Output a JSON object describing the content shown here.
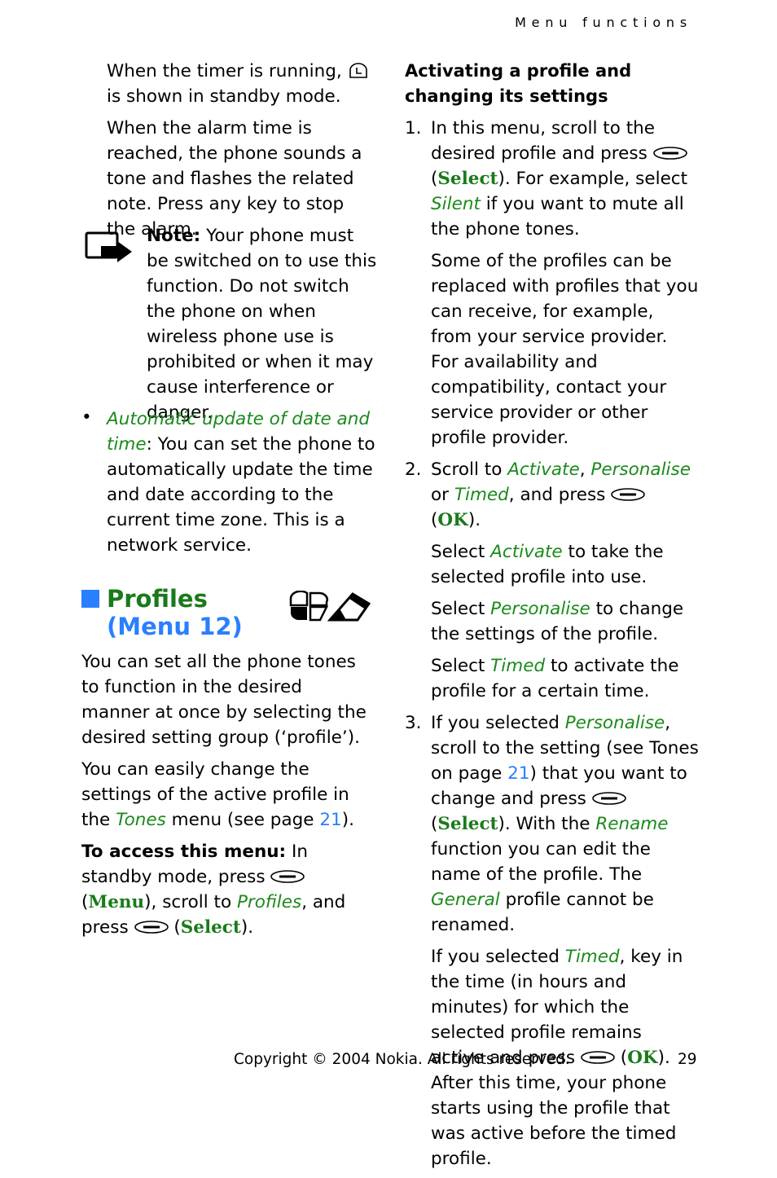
{
  "header": {
    "section": "Menu functions"
  },
  "left": {
    "timer_p1_a": "When the timer is running,",
    "timer_p1_b": "is shown in standby mode.",
    "alarm_p": "When the alarm time is reached, the phone sounds a tone and flashes the related note. Press any key to stop the alarm.",
    "note_label": "Note:",
    "note_text": "Your phone must be switched on to use this function. Do not switch the phone on when wireless phone use is prohibited or when it may cause interference or danger.",
    "bullet_link": "Automatic update of date and time",
    "bullet_text": ": You can set the phone to automatically update the time and date according to the current time zone. This is a network service.",
    "profiles_title": "Profiles",
    "profiles_menu": "(Menu 12)",
    "intro_p": "You can set all the phone tones to function in the desired manner at once by selecting the desired setting group (‘profile’).",
    "change_a": "You can easily change the settings of the active profile in the",
    "change_link": "Tones",
    "change_b": "menu (see page",
    "change_page": "21",
    "change_c": ").",
    "access_label": "To access this menu:",
    "access_a": "In standby mode, press",
    "access_menu": "Menu",
    "access_b": "), scroll to",
    "access_profiles": "Profiles",
    "access_c": ", and press",
    "access_select": "Select",
    "access_d": ")."
  },
  "right": {
    "heading": "Activating a profile and changing its settings",
    "s1_num": "1.",
    "s1_a": "In this menu, scroll to the desired profile and press",
    "s1_select": "Select",
    "s1_b": "). For example, select",
    "s1_silent": "Silent",
    "s1_c": "if you want to mute all the phone tones.",
    "s1_p2": "Some of the profiles can be replaced with profiles that you can receive, for example, from your service provider. For availability and compatibility, contact your service provider or other profile provider.",
    "s2_num": "2.",
    "s2_a": "Scroll to",
    "s2_activate": "Activate",
    "s2_personalise": "Personalise",
    "s2_or": "or",
    "s2_timed": "Timed",
    "s2_b": ", and press",
    "s2_ok": "OK",
    "s2_p2_a": "Select",
    "s2_p2_link": "Activate",
    "s2_p2_b": "to take the selected profile into use.",
    "s2_p3_a": "Select",
    "s2_p3_link": "Personalise",
    "s2_p3_b": "to change the settings of the profile.",
    "s2_p4_a": "Select",
    "s2_p4_link": "Timed",
    "s2_p4_b": "to activate the profile for a certain time.",
    "s3_num": "3.",
    "s3_a": "If you selected",
    "s3_personalise": "Personalise",
    "s3_b": ", scroll to the setting (see Tones on page",
    "s3_page": "21",
    "s3_c": ") that you want to change and press",
    "s3_select": "Select",
    "s3_d": "). With the",
    "s3_rename": "Rename",
    "s3_e": "function you can edit the name of the profile. The",
    "s3_general": "General",
    "s3_f": "profile cannot be renamed.",
    "s3_p2_a": "If you selected",
    "s3_p2_timed": "Timed",
    "s3_p2_b": ", key in the time (in hours and minutes) for which the selected profile remains active and press",
    "s3_p2_ok": "OK",
    "s3_p2_c": "). After this time, your phone starts using the profile that was active before the timed profile."
  },
  "footer": {
    "copyright": "Copyright © 2004 Nokia. All rights reserved.",
    "page": "29"
  }
}
